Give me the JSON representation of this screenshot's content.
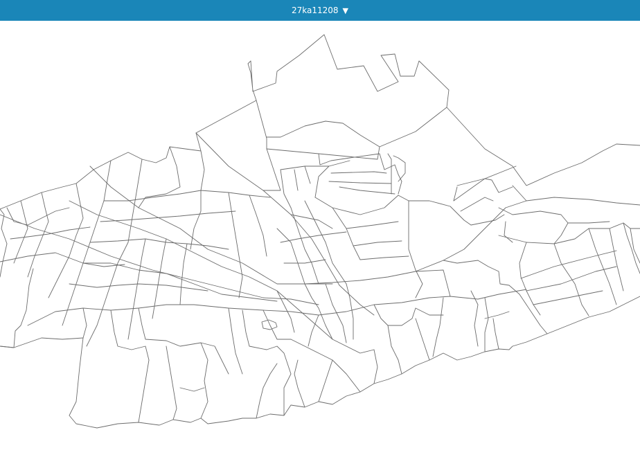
{
  "header": {
    "title": "27ka11208",
    "dropdown_icon": "triangle-down-icon"
  },
  "colors": {
    "header_bg": "#1a86b8",
    "header_text": "#ffffff",
    "boundary_stroke": "#6b6b6b",
    "map_bg": "#ffffff"
  }
}
